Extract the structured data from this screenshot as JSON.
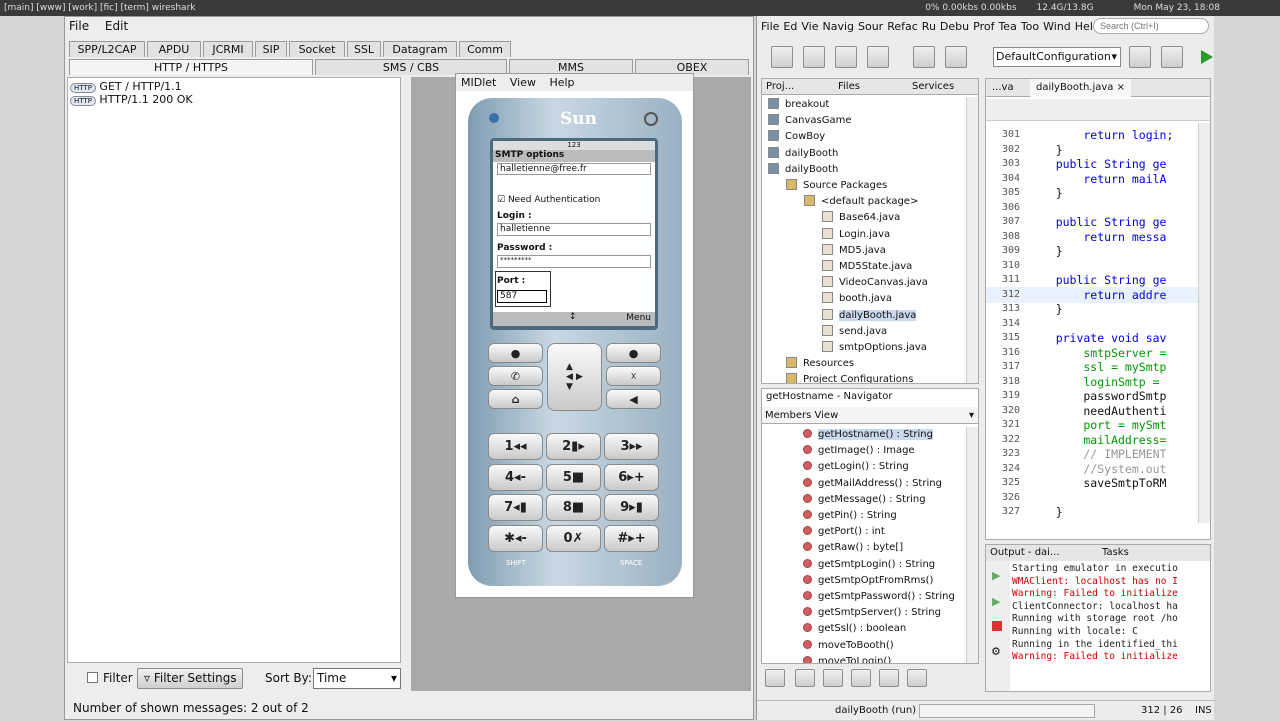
{
  "topbar": {
    "workspaces": "[main] [www] [work] [fic] [term] wireshark",
    "traffic": "0% 0.00kbs 0.00kbs",
    "disk": "12.4G/13.8G",
    "datetime": "Mon May 23, 18:08"
  },
  "left": {
    "menu": [
      "File",
      "Edit"
    ],
    "tabs": [
      "SPP/L2CAP",
      "APDU",
      "JCRMI",
      "SIP",
      "Socket",
      "SSL",
      "Datagram",
      "Comm"
    ],
    "tabs2": [
      "HTTP / HTTPS",
      "SMS / CBS",
      "MMS",
      "OBEX"
    ],
    "messages": [
      {
        "tag": "HTTP",
        "text": "GET / HTTP/1.1"
      },
      {
        "tag": "HTTP",
        "text": "HTTP/1.1 200 OK"
      }
    ],
    "filter": "Filter",
    "filter_settings": "Filter Settings",
    "sort_by": "Sort By:",
    "sort_value": "Time",
    "status": "Number of shown messages: 2 out of 2"
  },
  "phone": {
    "menu": [
      "MIDlet",
      "View",
      "Help"
    ],
    "brand": "Sun",
    "battery_num": "123",
    "screen_title": "SMTP options",
    "email": "halletienne@free.fr",
    "need_auth": "Need Authentication",
    "login_label": "Login :",
    "login": "halletienne",
    "password_label": "Password :",
    "password": "*********",
    "port_label": "Port :",
    "port": "587",
    "softkey_right": "Menu",
    "keys": [
      "1◂◂",
      "2▮▸",
      "3▸▸",
      "4◂-",
      "5■",
      "6▸+",
      "7◂▮",
      "8■",
      "9▸▮",
      "✱◂-",
      "0✗",
      "#▸+"
    ],
    "shift": "SHIFT",
    "space": "SPACE"
  },
  "ide": {
    "menu": [
      "File",
      "Ed",
      "Vie",
      "Navig",
      "Sour",
      "Refac",
      "Ru",
      "Debu",
      "Prof",
      "Tea",
      "Too",
      "Wind",
      "Hel"
    ],
    "search_placeholder": "Search (Ctrl+I)",
    "config": "DefaultConfiguration",
    "panel_tabs": [
      "Proj...",
      "Files",
      "Services"
    ],
    "tree": [
      {
        "t": "breakout",
        "d": 0
      },
      {
        "t": "CanvasGame",
        "d": 0
      },
      {
        "t": "CowBoy",
        "d": 0
      },
      {
        "t": "dailyBooth",
        "d": 0
      },
      {
        "t": "dailyBooth",
        "d": 0
      },
      {
        "t": "Source Packages",
        "d": 1
      },
      {
        "t": "<default package>",
        "d": 2
      },
      {
        "t": "Base64.java",
        "d": 3
      },
      {
        "t": "Login.java",
        "d": 3
      },
      {
        "t": "MD5.java",
        "d": 3
      },
      {
        "t": "MD5State.java",
        "d": 3
      },
      {
        "t": "VideoCanvas.java",
        "d": 3
      },
      {
        "t": "booth.java",
        "d": 3
      },
      {
        "t": "dailyBooth.java",
        "d": 3,
        "sel": true
      },
      {
        "t": "send.java",
        "d": 3
      },
      {
        "t": "smtpOptions.java",
        "d": 3
      },
      {
        "t": "Resources",
        "d": 1
      },
      {
        "t": "Project Configurations",
        "d": 1
      }
    ],
    "navigator_title": "getHostname - Navigator",
    "members_view": "Members View",
    "members": [
      "getHostname() : String",
      "getImage() : Image",
      "getLogin() : String",
      "getMailAddress() : String",
      "getMessage() : String",
      "getPin() : String",
      "getPort() : int",
      "getRaw() : byte[]",
      "getSmtpLogin() : String",
      "getSmtpOptFromRms()",
      "getSmtpPassword() : String",
      "getSmtpServer() : String",
      "getSsl() : boolean",
      "moveToBooth()",
      "moveToLogin()"
    ],
    "editor_tabs": [
      "...va",
      "dailyBooth.java"
    ],
    "code": [
      {
        "n": "301",
        "c": "        return login;"
      },
      {
        "n": "302",
        "c": "    }"
      },
      {
        "n": "303",
        "c": "    public String ge"
      },
      {
        "n": "304",
        "c": "        return mailA"
      },
      {
        "n": "305",
        "c": "    }"
      },
      {
        "n": "306",
        "c": ""
      },
      {
        "n": "307",
        "c": "    public String ge"
      },
      {
        "n": "308",
        "c": "        return messa"
      },
      {
        "n": "309",
        "c": "    }"
      },
      {
        "n": "310",
        "c": ""
      },
      {
        "n": "311",
        "c": "    public String ge"
      },
      {
        "n": "312",
        "c": "        return addre"
      },
      {
        "n": "313",
        "c": "    }"
      },
      {
        "n": "314",
        "c": ""
      },
      {
        "n": "315",
        "c": "    private void sav"
      },
      {
        "n": "316",
        "c": "        smtpServer ="
      },
      {
        "n": "317",
        "c": "        ssl = mySmtp"
      },
      {
        "n": "318",
        "c": "        loginSmtp ="
      },
      {
        "n": "319",
        "c": "        passwordSmtp"
      },
      {
        "n": "320",
        "c": "        needAuthenti"
      },
      {
        "n": "321",
        "c": "        port = mySmt"
      },
      {
        "n": "322",
        "c": "        mailAddress="
      },
      {
        "n": "323",
        "c": "        // IMPLEMENT"
      },
      {
        "n": "324",
        "c": "        //System.out"
      },
      {
        "n": "325",
        "c": "        saveSmtpToRM"
      },
      {
        "n": "326",
        "c": ""
      },
      {
        "n": "327",
        "c": "    }"
      }
    ],
    "output_tabs": [
      "Output - dai...",
      "Tasks"
    ],
    "output": [
      "Starting emulator in executio",
      "WMAClient: localhost has no I",
      "Warning: Failed to initialize",
      "ClientConnector: localhost ha",
      "Running with storage root /ho",
      "Running with locale: C",
      "Running in the identified_thi",
      "Warning: Failed to initialize"
    ],
    "status_run": "dailyBooth (run)",
    "caret": "312 | 26",
    "ins": "INS"
  }
}
